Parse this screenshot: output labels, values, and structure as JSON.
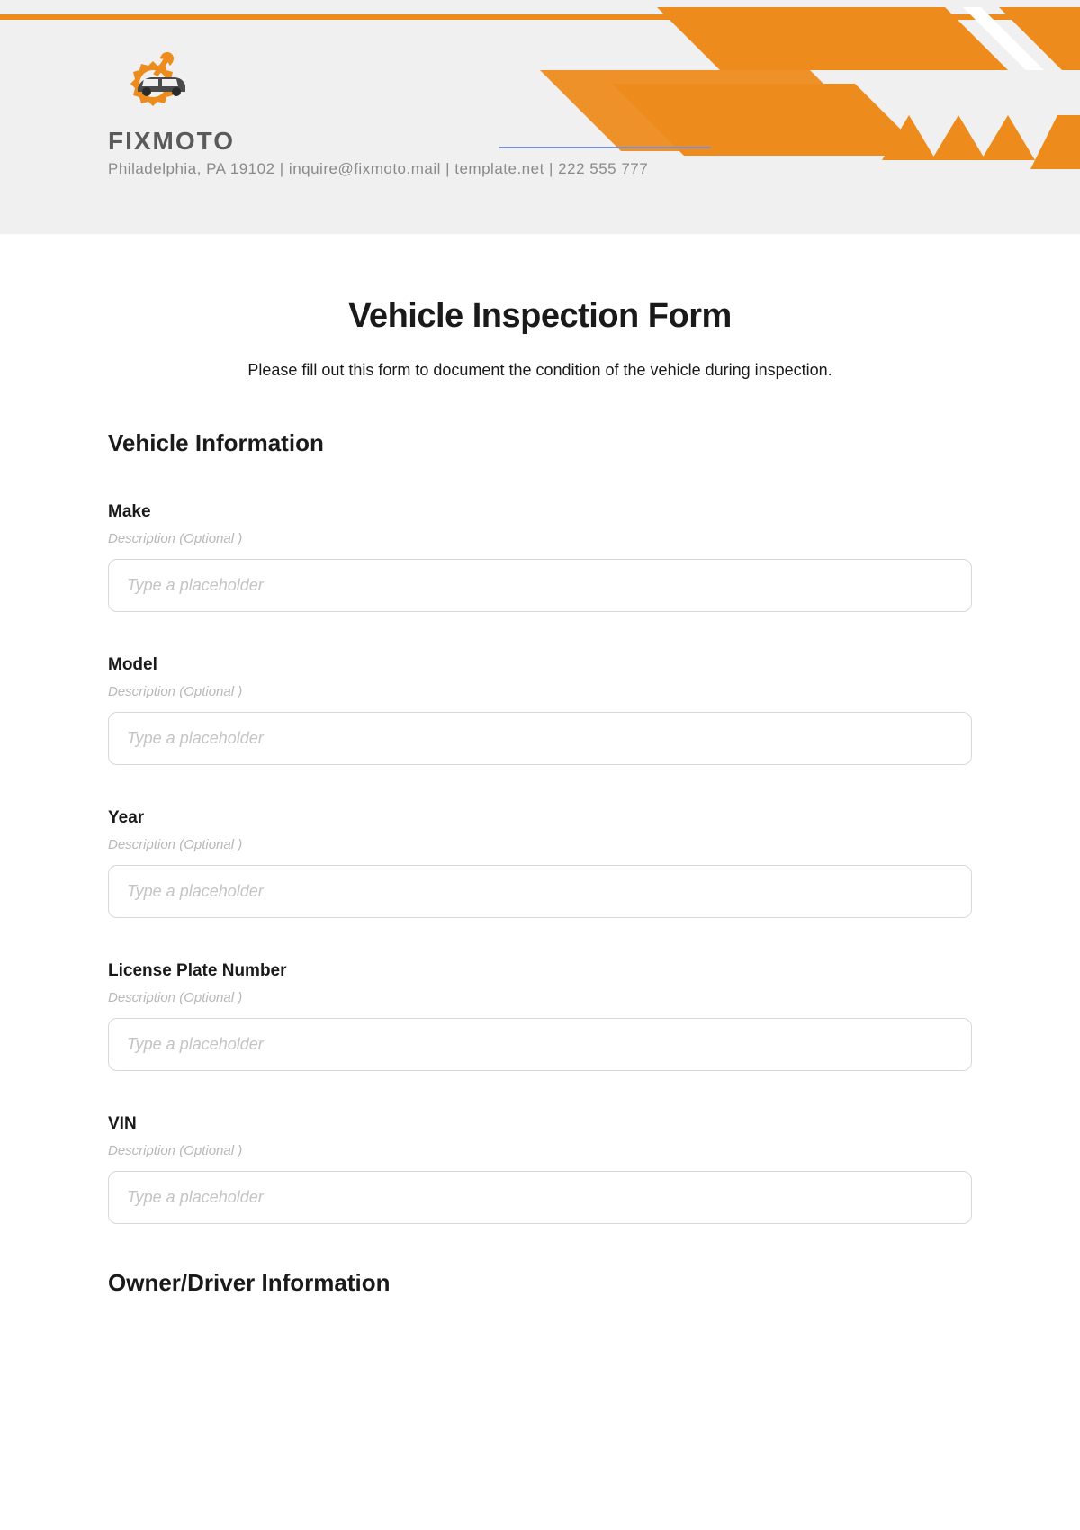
{
  "header": {
    "company_name": "FIXMOTO",
    "company_info": "Philadelphia, PA 19102 | inquire@fixmoto.mail | template.net | 222 555 777",
    "accent_color": "#ed8b1c"
  },
  "form": {
    "title": "Vehicle Inspection Form",
    "description": "Please fill out this form to document the condition of the vehicle during inspection.",
    "sections": [
      {
        "title": "Vehicle Information",
        "fields": [
          {
            "label": "Make",
            "description": "Description (Optional )",
            "placeholder": "Type a placeholder"
          },
          {
            "label": "Model",
            "description": "Description (Optional )",
            "placeholder": "Type a placeholder"
          },
          {
            "label": "Year",
            "description": "Description (Optional )",
            "placeholder": "Type a placeholder"
          },
          {
            "label": "License Plate Number",
            "description": "Description (Optional )",
            "placeholder": "Type a placeholder"
          },
          {
            "label": "VIN",
            "description": "Description (Optional )",
            "placeholder": "Type a placeholder"
          }
        ]
      },
      {
        "title": "Owner/Driver Information"
      }
    ]
  }
}
